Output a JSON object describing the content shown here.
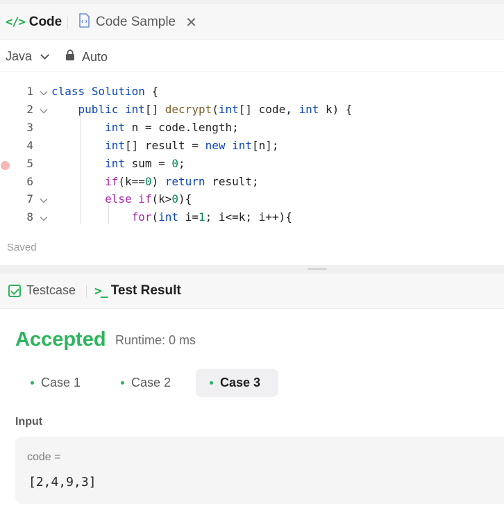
{
  "editor": {
    "tabs": {
      "code_label": "Code",
      "sample_label": "Code Sample"
    },
    "toolbar": {
      "language": "Java",
      "format_mode": "Auto"
    },
    "code_lines": [
      {
        "num": "1",
        "text": "class Solution {",
        "foldable": true
      },
      {
        "num": "2",
        "text": "    public int[] decrypt(int[] code, int k) {",
        "foldable": true
      },
      {
        "num": "3",
        "text": "        int n = code.length;",
        "foldable": false
      },
      {
        "num": "4",
        "text": "        int[] result = new int[n];",
        "foldable": false
      },
      {
        "num": "5",
        "text": "        int sum = 0;",
        "foldable": false,
        "breakpoint": true
      },
      {
        "num": "6",
        "text": "        if(k==0) return result;",
        "foldable": false
      },
      {
        "num": "7",
        "text": "        else if(k>0){",
        "foldable": true
      },
      {
        "num": "8",
        "text": "            for(int i=1; i<=k; i++){",
        "foldable": true
      }
    ],
    "status": "Saved"
  },
  "result": {
    "tabs": {
      "testcase_label": "Testcase",
      "result_label": "Test Result"
    },
    "verdict": "Accepted",
    "runtime": "Runtime: 0 ms",
    "cases": [
      "Case 1",
      "Case 2",
      "Case 3"
    ],
    "active_case": "Case 3",
    "input_label": "Input",
    "input_name": "code =",
    "input_value": "[2,4,9,3]"
  },
  "colors": {
    "accent_green": "#2db55d",
    "keyword_blue": "#0b46b8",
    "keyword_purple": "#a626a4",
    "breakpoint": "#f2b8b8"
  },
  "icons": {
    "code_tab": "code-brackets-icon",
    "sample_tab": "file-code-icon",
    "close": "close-icon",
    "language_dropdown": "chevron-down-icon",
    "auto": "lock-icon",
    "testcase_tab": "checkbox-icon",
    "result_tab": "terminal-icon"
  }
}
